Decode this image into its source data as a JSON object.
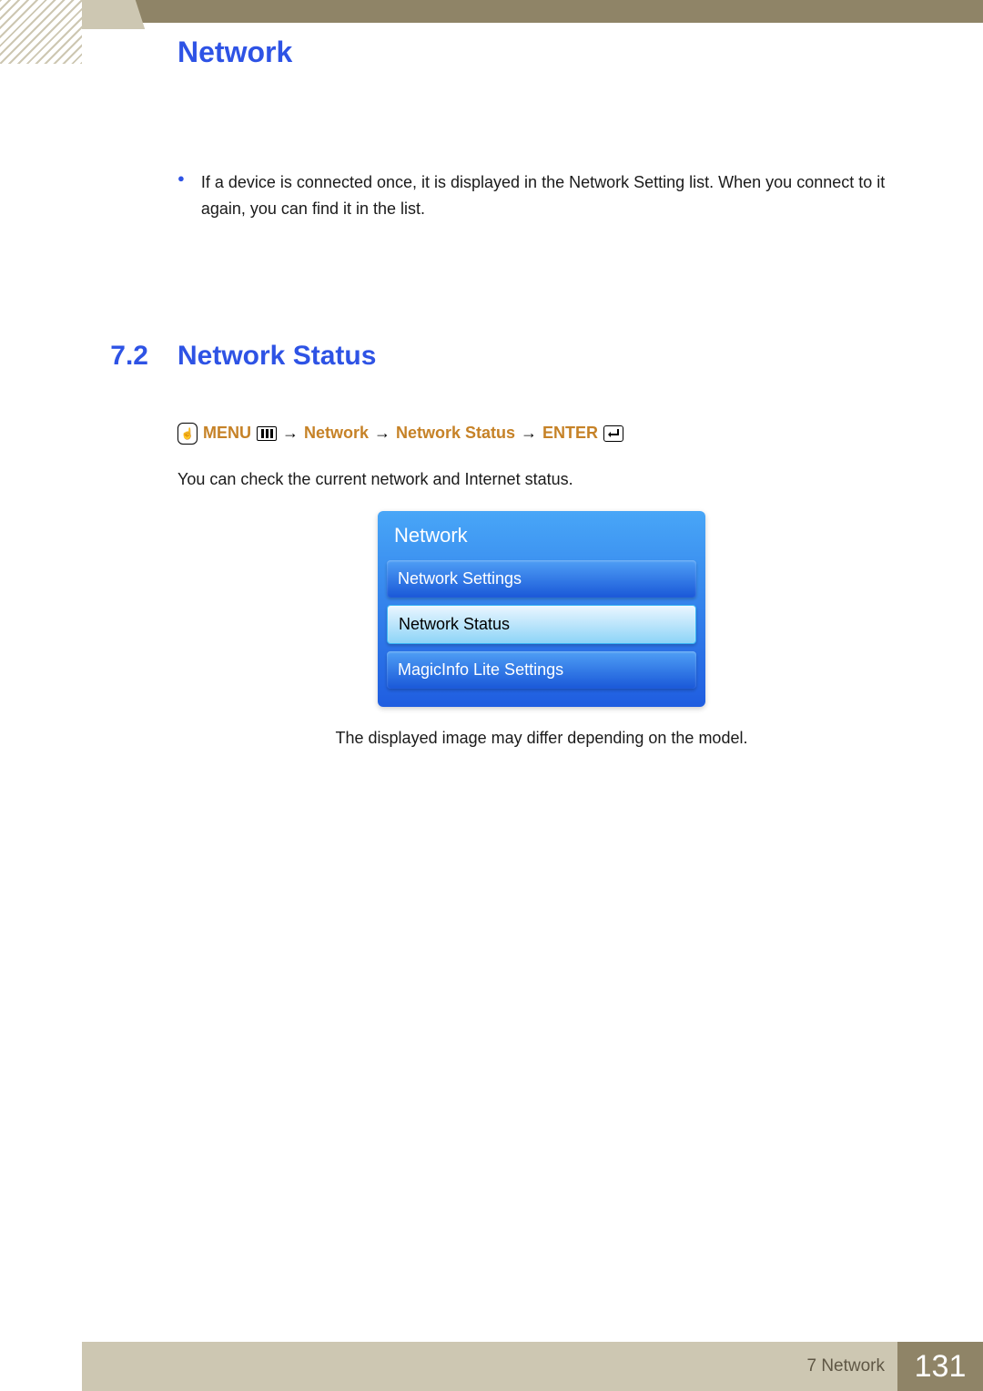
{
  "chapter_title": "Network",
  "bullet": "If a device is connected once, it is displayed in the Network Setting list. When you connect to it again, you can find it in the list.",
  "section": {
    "num": "7.2",
    "heading": "Network Status"
  },
  "path": {
    "menu": "MENU",
    "arrow": "→",
    "p1": "Network",
    "p2": "Network Status",
    "enter": "ENTER"
  },
  "desc": "You can check the current network and Internet status.",
  "osd": {
    "title": "Network",
    "items": [
      {
        "label": "Network Settings",
        "selected": false
      },
      {
        "label": "Network Status",
        "selected": true
      },
      {
        "label": "MagicInfo Lite Settings",
        "selected": false
      }
    ]
  },
  "note": "The displayed image may differ depending on the model.",
  "footer": {
    "chapter": "7 Network",
    "page": "131"
  }
}
